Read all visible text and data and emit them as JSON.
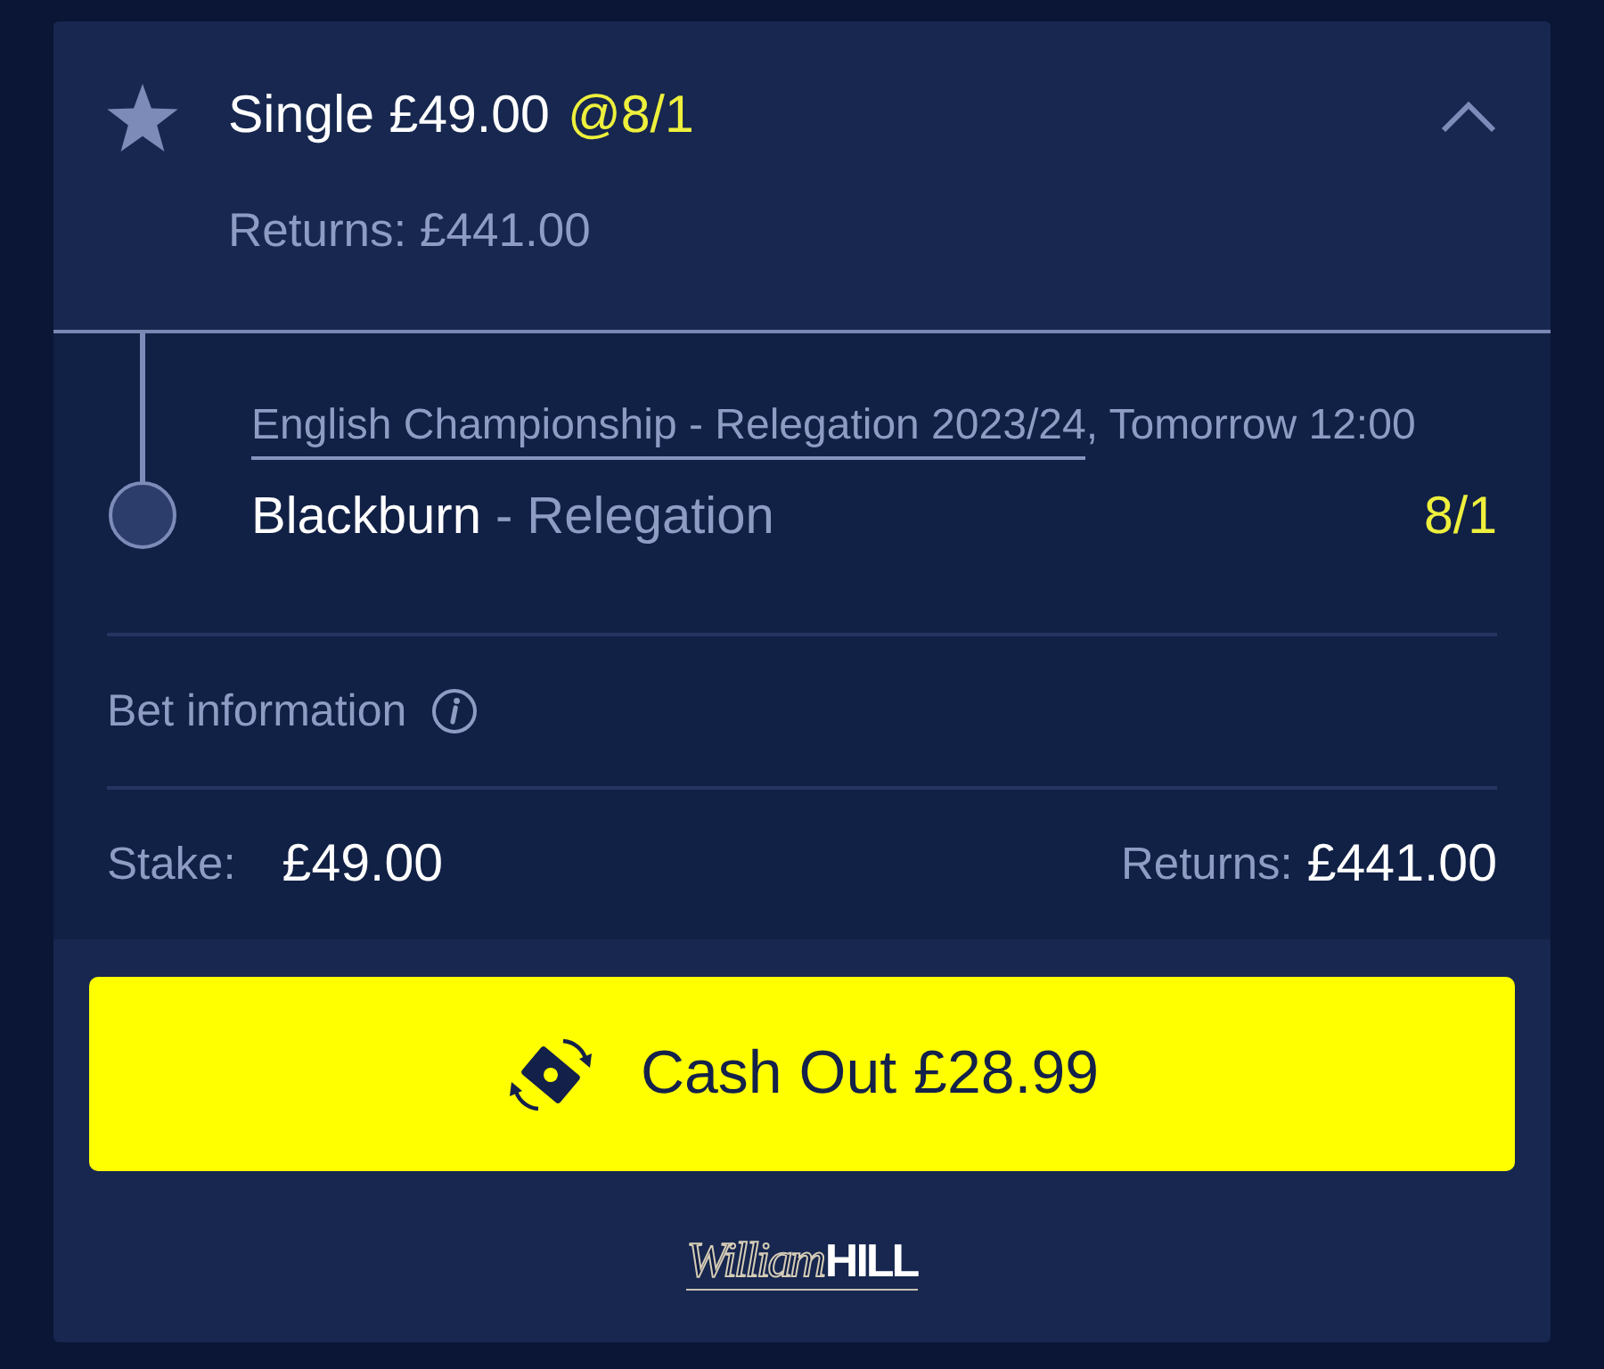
{
  "bet": {
    "title": "Single £49.00",
    "odds": "@8/1",
    "returns": "Returns: £441.00",
    "expanded": true
  },
  "selection": {
    "event": "English Championship - Relegation 2023/24",
    "event_time": ", Tomorrow 12:00",
    "name": "Blackburn",
    "market": "- Relegation",
    "odds": "8/1"
  },
  "bet_information": {
    "label": "Bet information"
  },
  "summary": {
    "stake_label": "Stake:",
    "stake": "£49.00",
    "returns_label": "Returns:",
    "returns": "£441.00"
  },
  "cash_out": {
    "label": "Cash Out £28.99"
  },
  "logo": {
    "script": "William",
    "wordmark": "HILL"
  }
}
